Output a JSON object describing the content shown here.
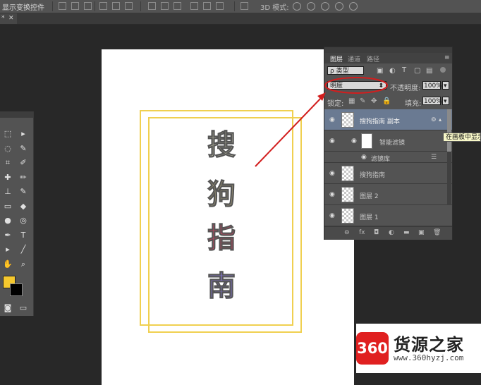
{
  "options_bar": {
    "label": "显示变换控件",
    "mode_3d": "3D 模式:"
  },
  "document_tab": {
    "label": "*"
  },
  "canvas": {
    "characters": [
      {
        "text": "搜",
        "color": "#b8b8a0"
      },
      {
        "text": "狗",
        "color": "#a09878"
      },
      {
        "text": "指",
        "color": "#d04060"
      },
      {
        "text": "南",
        "color": "#8878d8"
      }
    ],
    "frame_color": "#f0d050"
  },
  "tools": {
    "icons": [
      "marquee-icon",
      "move-icon",
      "lasso-icon",
      "quick-select-icon",
      "crop-icon",
      "eyedropper-icon",
      "healing-icon",
      "brush-icon",
      "stamp-icon",
      "history-brush-icon",
      "eraser-icon",
      "paint-bucket-icon",
      "blur-icon",
      "dodge-icon",
      "pen-icon",
      "type-icon",
      "path-select-icon",
      "line-icon",
      "hand-icon",
      "zoom-icon"
    ],
    "glyphs": [
      "⬚",
      "▸",
      "◌",
      "✎",
      "⌗",
      "✐",
      "✚",
      "✏",
      "⊥",
      "✎",
      "▭",
      "◆",
      "●",
      "◎",
      "✒",
      "T",
      "▸",
      "╱",
      "✋",
      "⌕"
    ],
    "foreground_color": "#f5c82e",
    "background_color": "#000000"
  },
  "layers_panel": {
    "tabs": [
      "图层",
      "通道",
      "路径"
    ],
    "filter_kind": "ρ 类型",
    "blend_mode": "明度",
    "opacity_label": "不透明度:",
    "opacity_value": "100%",
    "lock_label": "锁定:",
    "fill_label": "填充:",
    "fill_value": "100%",
    "layers": [
      {
        "name": "搜狗指南 副本",
        "selected": true,
        "smart_object": true
      },
      {
        "name": "智能滤镜",
        "sub": true
      },
      {
        "name": "滤镜库",
        "sub": true
      },
      {
        "name": "搜狗指南",
        "smart_object": true
      },
      {
        "name": "图层 2"
      },
      {
        "name": "图层 1"
      }
    ],
    "footer_icons": [
      "link-icon",
      "fx-icon",
      "mask-icon",
      "adjustment-icon",
      "group-icon",
      "new-layer-icon",
      "trash-icon"
    ],
    "footer_glyphs": [
      "⊖",
      "fx",
      "◘",
      "◐",
      "▬",
      "▣",
      "🗑"
    ]
  },
  "tooltip": {
    "text": "在画板中显示"
  },
  "watermark": {
    "badge": "360",
    "name": "货源之家",
    "url": "www.360hyzj.com"
  },
  "annotation_color": "#d21e1e"
}
